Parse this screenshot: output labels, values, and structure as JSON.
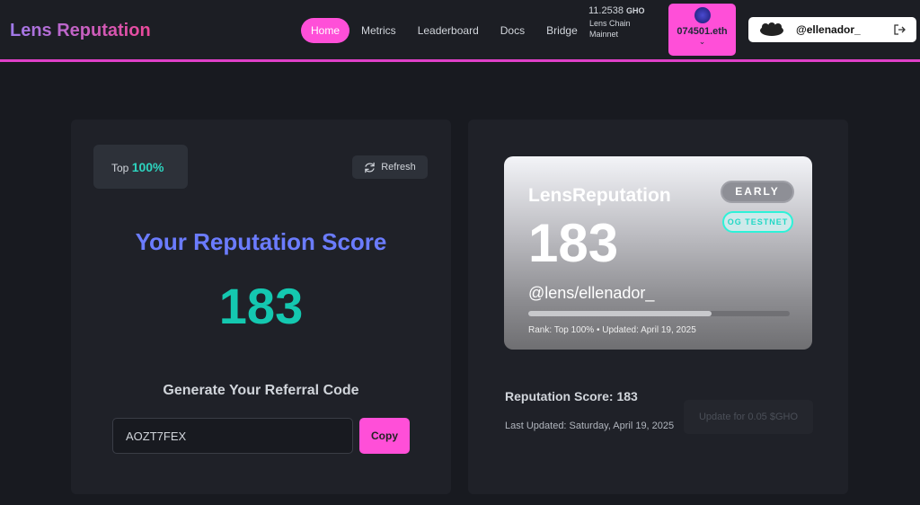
{
  "nav": {
    "logo": "Lens Reputation",
    "links": [
      {
        "label": "Home",
        "active": true
      },
      {
        "label": "Metrics"
      },
      {
        "label": "Leaderboard"
      },
      {
        "label": "Docs"
      },
      {
        "label": "Bridge"
      }
    ],
    "balance": "11.2538",
    "balance_unit": "GHO",
    "chain": "Lens Chain Mainnet",
    "wallet": "074501.eth",
    "user": "@ellenador_",
    "accent": "#ff4fd8"
  },
  "left": {
    "top_label": "Top",
    "top_value": "100%",
    "refresh": "Refresh",
    "title": "Your Reputation Score",
    "score": "183",
    "referral_title": "Generate Your Referral Code",
    "referral_code": "AOZT7FEX",
    "copy": "Copy"
  },
  "badge": {
    "title": "LensReputation",
    "score": "183",
    "handle": "@lens/ellenador_",
    "early": "EARLY",
    "og": "OG TESTNET",
    "progress_percent": 70,
    "meta": "Rank: Top 100% • Updated: April 19, 2025"
  },
  "right": {
    "score_line": "Reputation Score: 183",
    "last_updated": "Last Updated: Saturday, April 19, 2025",
    "update_button": "Update for 0.05 $GHO"
  }
}
